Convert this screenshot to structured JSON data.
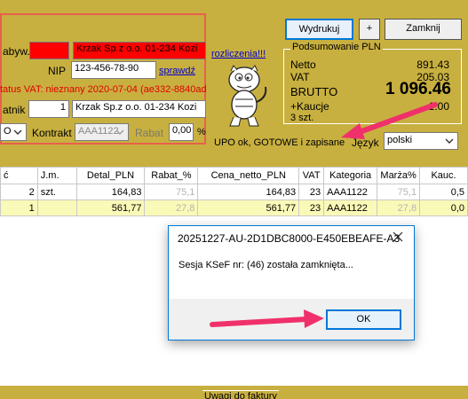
{
  "left": {
    "nabywca_label": "abyw.",
    "nabywca_name": "Krzak Sp.z o.o.  01-234 Kozi",
    "nip_label": "NIP",
    "nip_value": "123-456-78-90",
    "check_link": "sprawdź",
    "vat_status": "tatus VAT: nieznany 2020-07-04 (ae332-8840ad",
    "platnik_label": "atnik",
    "platnik_num": "1",
    "platnik_name": "Krzak Sp.z o.o.  01-234 Kozi",
    "combo1_value": "O",
    "kontrakt_label": "Kontrakt",
    "kontrakt_value": "AAA1122",
    "rabat_label": "Rabat",
    "rabat_value": "0,00",
    "pct": "%"
  },
  "links": {
    "rozliczenia": "rozliczenia!!!"
  },
  "toolbar": {
    "print": "Wydrukuj",
    "plus": "+",
    "close": "Zamknij"
  },
  "summary": {
    "title": "Podsumowanie  PLN",
    "netto_label": "Netto",
    "netto_value": "891.43",
    "vat_label": "VAT",
    "vat_value": "205.03",
    "brutto_label": "BRUTTO",
    "brutto_value": "1 096.46",
    "kaucje_label": "+Kaucje",
    "kaucje_value": "1.00",
    "count": "3 szt."
  },
  "upo_status": "UPO ok, GOTOWE i zapisane",
  "language": {
    "label": "Język",
    "value": "polski"
  },
  "table": {
    "headers": [
      "ć",
      "J.m.",
      "Detal_PLN",
      "Rabat_%",
      "Cena_netto_PLN",
      "VAT",
      "Kategoria",
      "Marża%",
      "Kauc."
    ],
    "rows": [
      [
        "2",
        "szt.",
        "164,83",
        "75,1",
        "164,83",
        "23",
        "AAA1122",
        "75,1",
        "0,5"
      ],
      [
        "1",
        "",
        "561,77",
        "27,8",
        "561,77",
        "23",
        "AAA1122",
        "27,8",
        "0,0"
      ]
    ]
  },
  "dialog": {
    "title": "20251227-AU-2D1DBC8000-E450EBEAFE-A3",
    "message": "Sesja KSeF nr: (46) została zamknięta...",
    "ok": "OK"
  },
  "footer": {
    "uwagi": "Uwagi do faktury"
  },
  "colors": {
    "background": "#C8B040",
    "accent": "#0078D7",
    "arrow": "#F0306A",
    "status_red": "#E00000"
  }
}
